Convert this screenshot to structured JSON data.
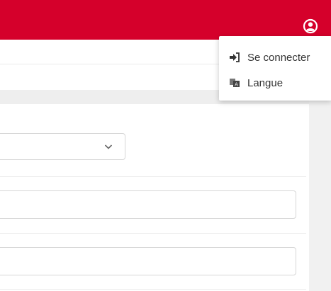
{
  "header": {
    "bg_color": "#d5002b",
    "user_icon": "user-circle-icon"
  },
  "user_menu": {
    "items": [
      {
        "label": "Se connecter",
        "icon": "sign-in-icon"
      },
      {
        "label": "Langue",
        "icon": "language-icon"
      }
    ]
  },
  "form": {
    "select": {
      "selected": "",
      "icon": "chevron-down-icon"
    },
    "fields": [
      {
        "value": "",
        "placeholder": ""
      },
      {
        "value": "",
        "placeholder": ""
      }
    ]
  }
}
